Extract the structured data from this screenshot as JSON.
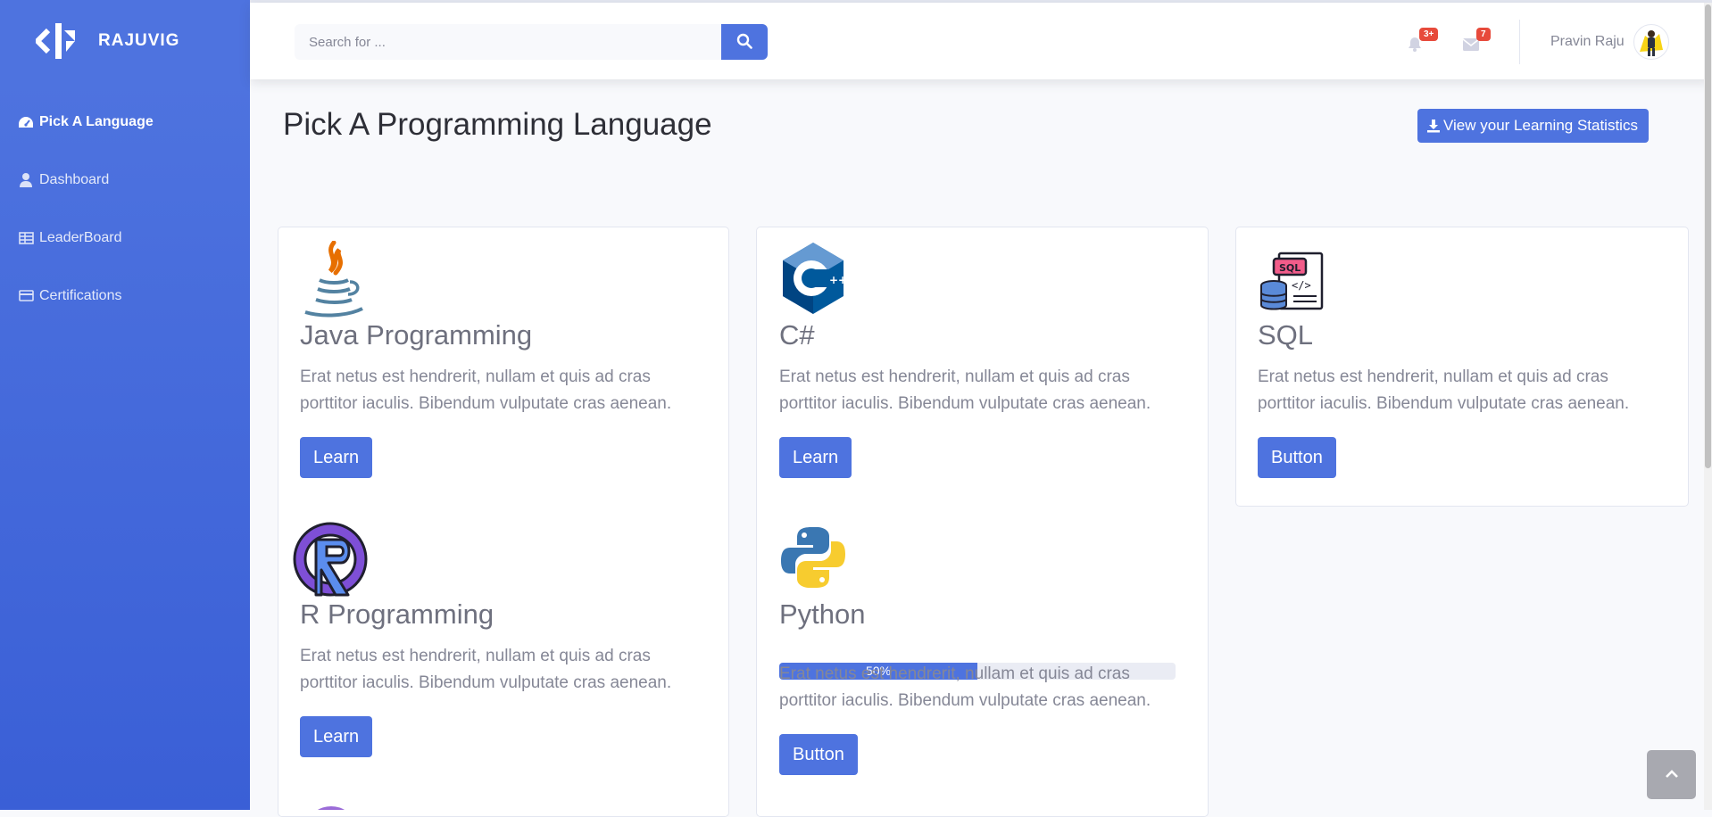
{
  "sidebar": {
    "brand": "RAJUVIG",
    "items": [
      {
        "label": "Pick A Language",
        "icon": "tachometer-icon"
      },
      {
        "label": "Dashboard",
        "icon": "user-icon"
      },
      {
        "label": "LeaderBoard",
        "icon": "table-icon"
      },
      {
        "label": "Certifications",
        "icon": "credit-card-icon"
      }
    ]
  },
  "topbar": {
    "search_placeholder": "Search for ...",
    "alerts_badge": "3+",
    "messages_badge": "7",
    "user_name": "Pravin Raju"
  },
  "main": {
    "title": "Pick A Programming Language",
    "stats_button": "View your Learning Statistics",
    "courses": [
      {
        "name": "Java Programming",
        "description": "Erat netus est hendrerit, nullam et quis ad cras porttitor iaculis. Bibendum vulputate cras aenean.",
        "button": "Learn",
        "icon": "java-icon"
      },
      {
        "name": "C#",
        "description": "Erat netus est hendrerit, nullam et quis ad cras porttitor iaculis. Bibendum vulputate cras aenean.",
        "button": "Learn",
        "icon": "c-sharp-icon"
      },
      {
        "name": "SQL",
        "description": "Erat netus est hendrerit, nullam et quis ad cras porttitor iaculis. Bibendum vulputate cras aenean.",
        "button": "Button",
        "icon": "sql-icon"
      },
      {
        "name": "R Programming",
        "description": "Erat netus est hendrerit, nullam et quis ad cras porttitor iaculis. Bibendum vulputate cras aenean.",
        "button": "Learn",
        "icon": "r-language-icon"
      },
      {
        "name": "Python",
        "description": "Erat netus est hendrerit, nullam et quis ad cras porttitor iaculis. Bibendum vulputate cras aenean.",
        "button": "Button",
        "icon": "python-icon",
        "progress": 50,
        "progress_label": "50%"
      }
    ]
  },
  "colors": {
    "primary": "#4e73df",
    "danger": "#e74a3b",
    "text_muted": "#858796"
  }
}
